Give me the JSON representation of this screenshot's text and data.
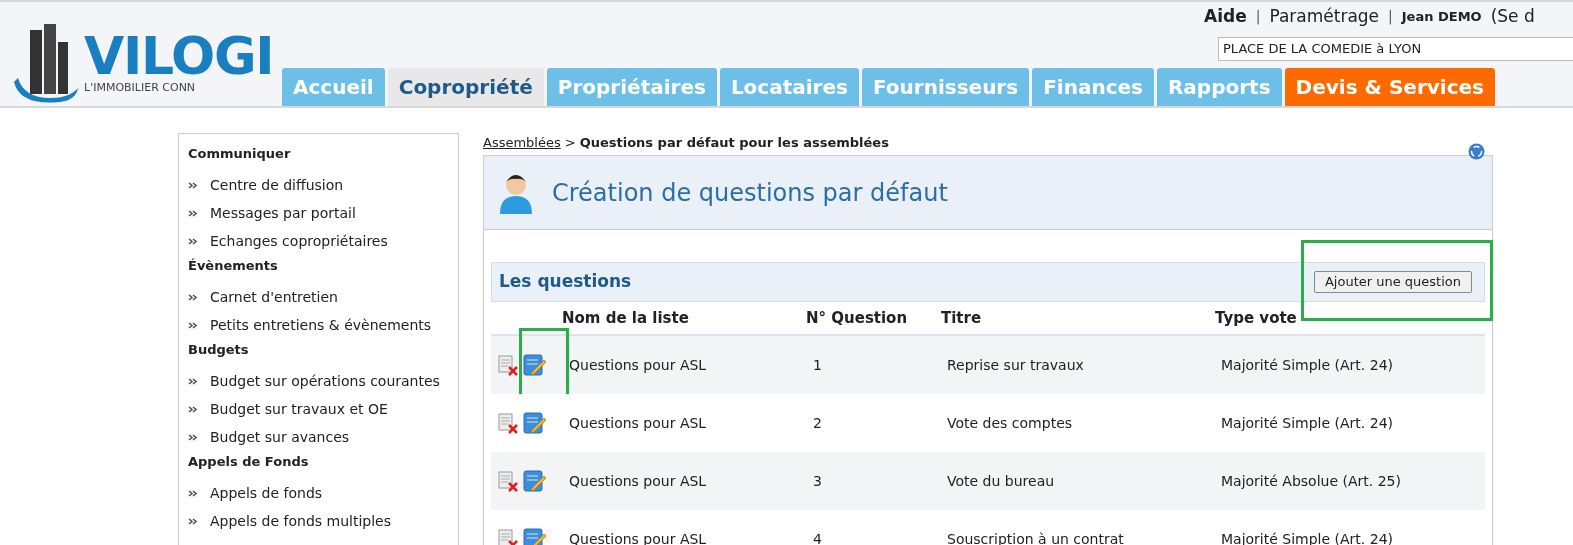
{
  "logo": {
    "name": "VILOGI",
    "tagline": "L'IMMOBILIER CONN"
  },
  "top_links": [
    {
      "label": "Aide",
      "kind": "bold"
    },
    {
      "label": "|",
      "kind": "separator"
    },
    {
      "label": "Paramétrage",
      "kind": "plain"
    },
    {
      "label": "|",
      "kind": "separator"
    },
    {
      "label": "Jean DEMO",
      "kind": "user"
    },
    {
      "label": "(Se d",
      "kind": "plain"
    }
  ],
  "building_field": {
    "value": "PLACE DE LA COMEDIE à LYON"
  },
  "tabs": [
    {
      "label": "Accueil",
      "selected": false,
      "kind": "normal"
    },
    {
      "label": "Copropriété",
      "selected": true,
      "kind": "normal"
    },
    {
      "label": "Propriétaires",
      "selected": false,
      "kind": "normal"
    },
    {
      "label": "Locataires",
      "selected": false,
      "kind": "normal"
    },
    {
      "label": "Fournisseurs",
      "selected": false,
      "kind": "normal"
    },
    {
      "label": "Finances",
      "selected": false,
      "kind": "normal"
    },
    {
      "label": "Rapports",
      "selected": false,
      "kind": "normal"
    },
    {
      "label": "Devis & Services",
      "selected": false,
      "kind": "promo"
    }
  ],
  "sidebar": {
    "sections": [
      {
        "title": "Communiquer",
        "items": [
          "Centre de diffusion",
          "Messages par portail",
          "Echanges copropriétaires"
        ]
      },
      {
        "title": "Évènements",
        "items": [
          "Carnet d'entretien",
          "Petits entretiens & évènements"
        ]
      },
      {
        "title": "Budgets",
        "items": [
          "Budget sur opérations courantes",
          "Budget sur travaux et OE",
          "Budget sur avances"
        ]
      },
      {
        "title": "Appels de Fonds",
        "items": [
          "Appels de fonds",
          "Appels de fonds multiples"
        ]
      }
    ]
  },
  "breadcrumb": {
    "link": "Assemblées",
    "separator": ">",
    "current": "Questions par défaut pour les assemblées"
  },
  "page_title": "Création de questions par défaut",
  "panel": {
    "title": "Les questions",
    "add_button": {
      "label": "Ajouter une question",
      "highlighted": true
    },
    "columns": [
      "Nom de la liste",
      "N° Question",
      "Titre",
      "Type vote"
    ],
    "rows": [
      {
        "list": "Questions pour ASL",
        "number": "1",
        "title": "Reprise sur travaux",
        "vote": "Majorité Simple (Art. 24)",
        "edit_highlighted": true
      },
      {
        "list": "Questions pour ASL",
        "number": "2",
        "title": "Vote des comptes",
        "vote": "Majorité Simple (Art. 24)",
        "edit_highlighted": false
      },
      {
        "list": "Questions pour ASL",
        "number": "3",
        "title": "Vote du bureau",
        "vote": "Majorité Absolue (Art. 25)",
        "edit_highlighted": false
      },
      {
        "list": "Questions pour ASL",
        "number": "4",
        "title": "Souscription à un contrat",
        "vote": "Majorité Simple (Art. 24)",
        "edit_highlighted": false
      }
    ]
  }
}
